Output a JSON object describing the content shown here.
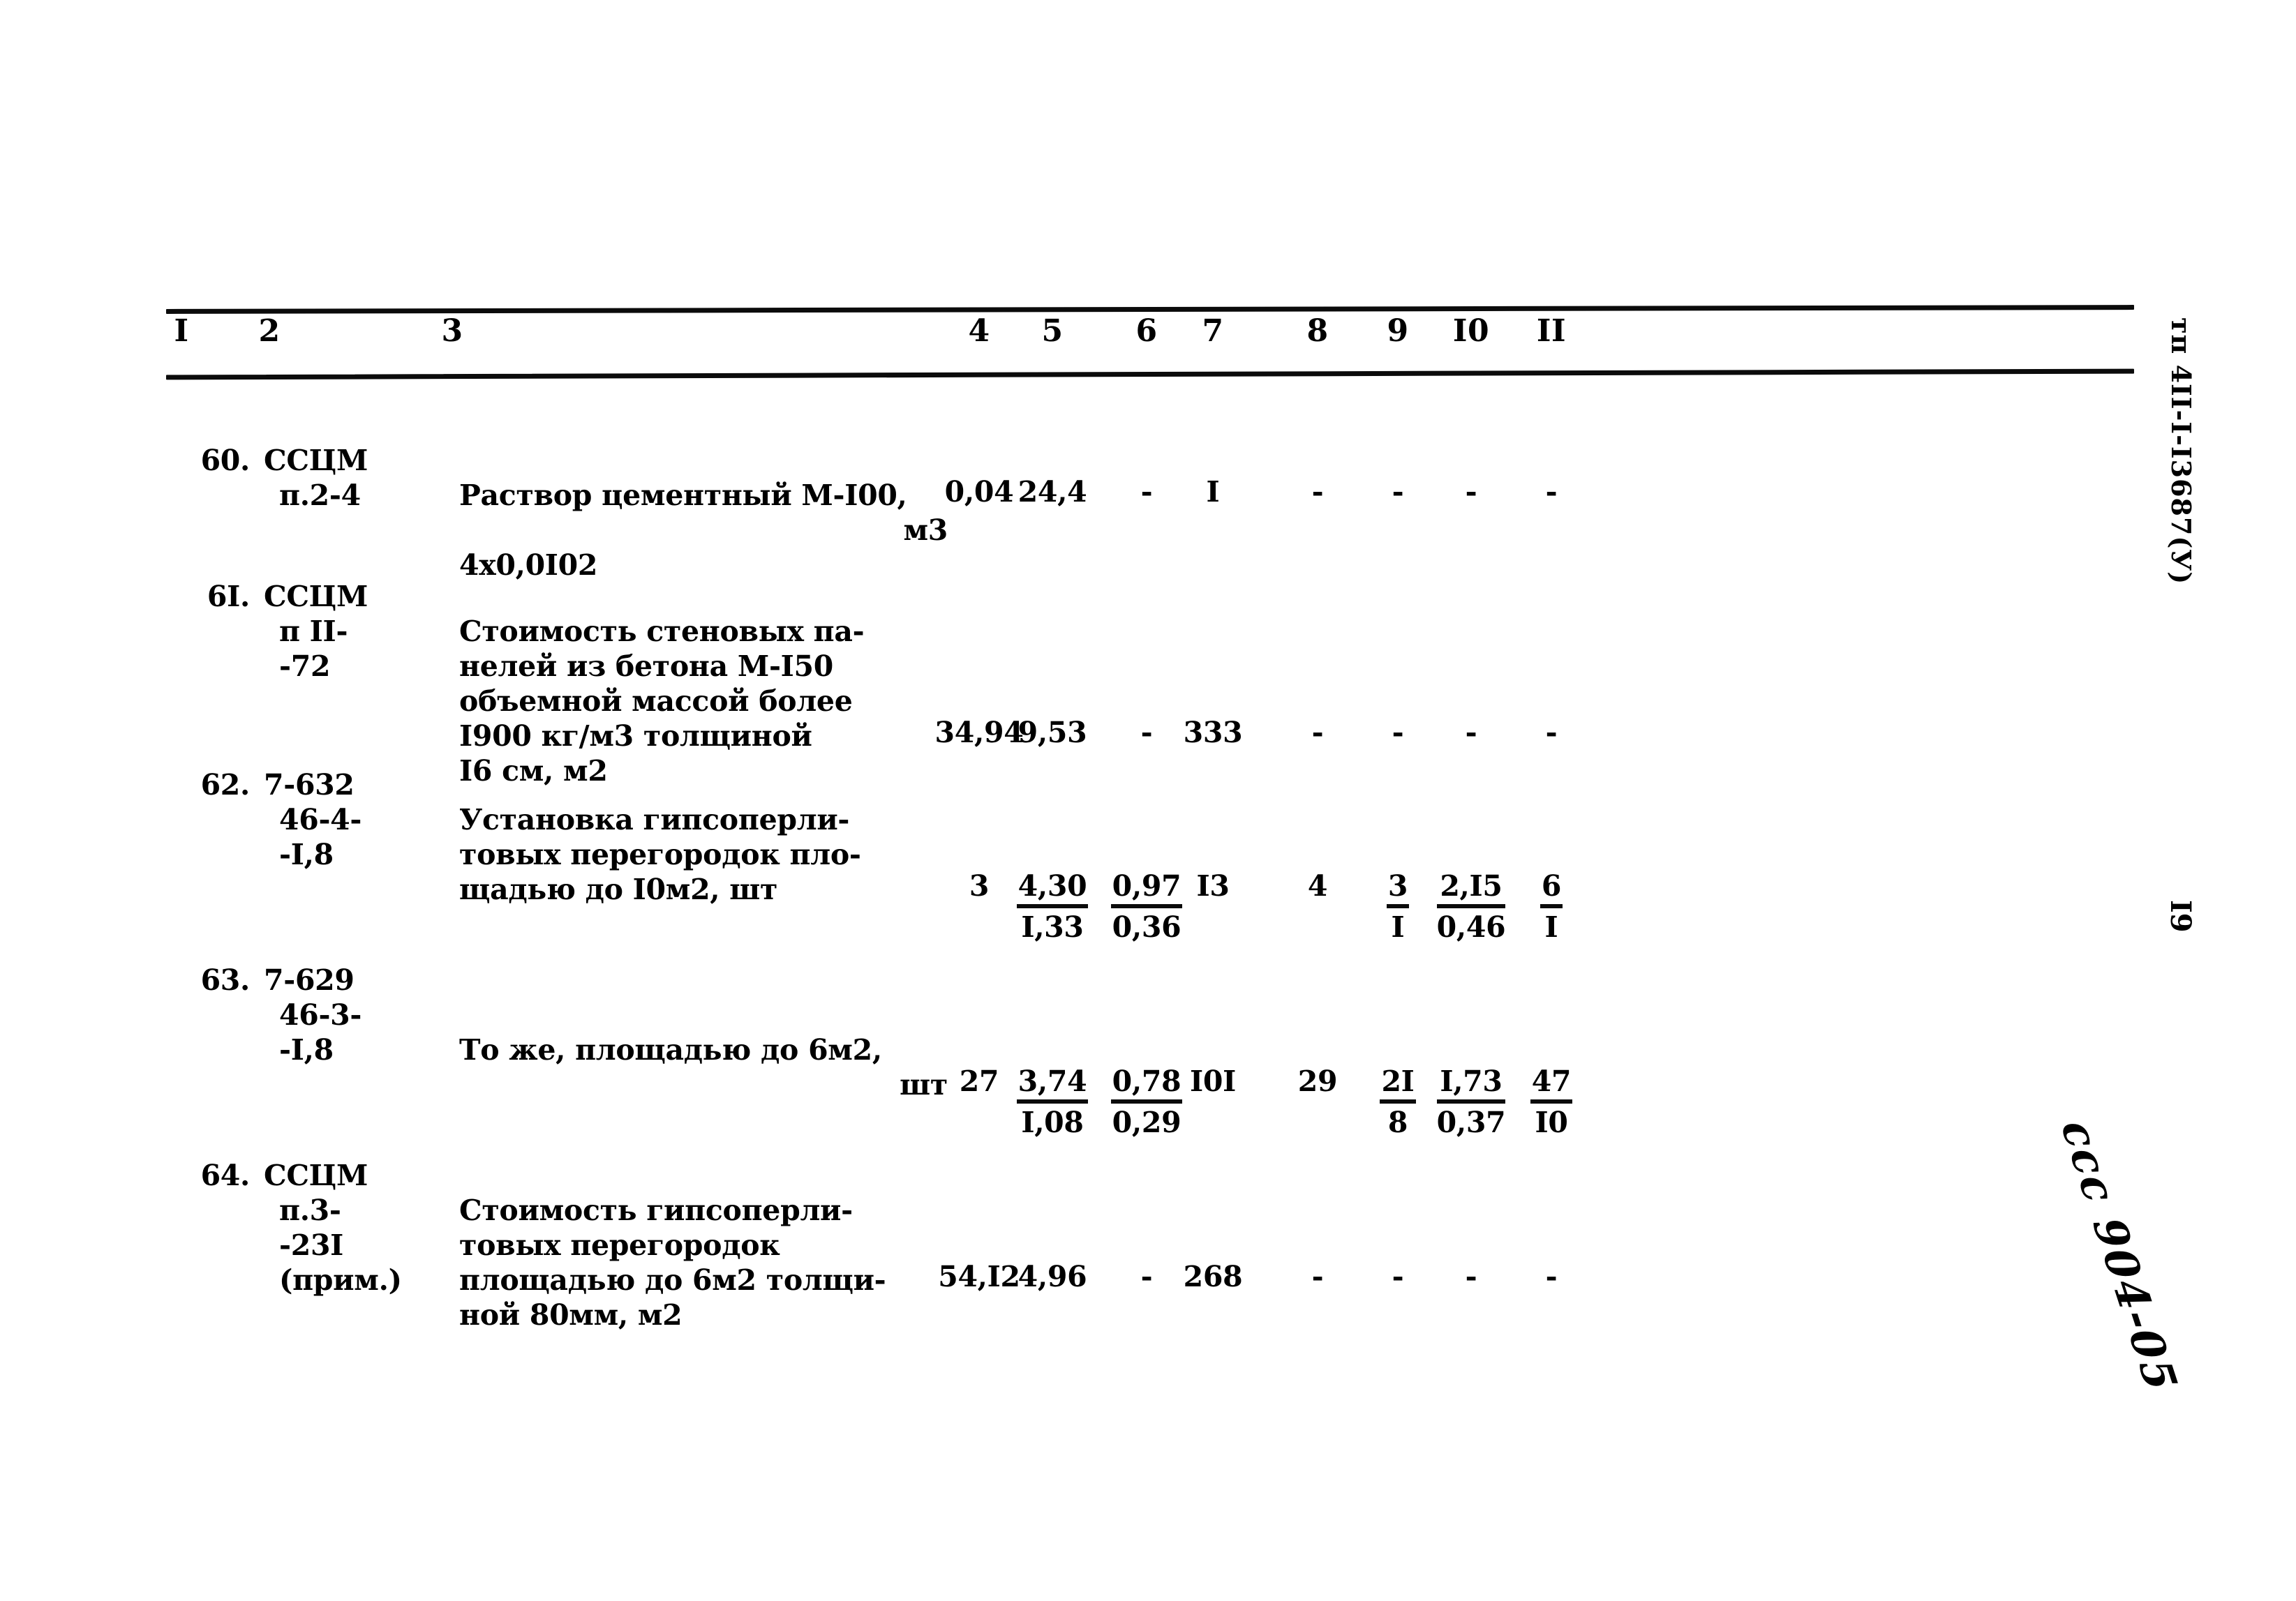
{
  "document": {
    "doc_code_margin": "тп 4II-I-I3687(У)",
    "page_number_margin": "I9",
    "handwritten_note": "ссс 904-05"
  },
  "table": {
    "column_headers": [
      "I",
      "2",
      "3",
      "4",
      "5",
      "6",
      "7",
      "8",
      "9",
      "I0",
      "II"
    ],
    "rows": [
      {
        "no": "60.",
        "code_lines": [
          "ССЦМ",
          "п.2-4"
        ],
        "desc_lines": [
          {
            "text": "Раствор цементный М-I00,",
            "align": "left"
          },
          {
            "text": "м3",
            "align": "right"
          },
          {
            "text": "4x0,0I02",
            "align": "left"
          }
        ],
        "c4": "0,04",
        "c5": "24,4",
        "c6": "-",
        "c7": "I",
        "c8": "-",
        "c9": "-",
        "c10": "-",
        "c11": "-"
      },
      {
        "no": "6I.",
        "code_lines": [
          "ССЦМ",
          "п II-",
          "-72"
        ],
        "desc_lines": [
          {
            "text": "Стоимость стеновых па-",
            "align": "left"
          },
          {
            "text": "нелей из бетона М-I50",
            "align": "left"
          },
          {
            "text": "объемной массой более",
            "align": "left"
          },
          {
            "text": "I900 кг/м3 толщиной",
            "align": "left"
          },
          {
            "text": "I6 см, м2",
            "align": "left"
          }
        ],
        "c4": "34,94",
        "c5": "9,53",
        "c6": "-",
        "c7": "333",
        "c8": "-",
        "c9": "-",
        "c10": "-",
        "c11": "-"
      },
      {
        "no": "62.",
        "code_lines": [
          "7-632",
          "46-4-",
          "-I,8"
        ],
        "desc_lines": [
          {
            "text": "Установка гипсоперли-",
            "align": "left"
          },
          {
            "text": "товых перегородок пло-",
            "align": "left"
          },
          {
            "text": "щадью до I0м2, шт",
            "align": "left"
          }
        ],
        "c4": "3",
        "c5": {
          "num": "4,30",
          "den": "I,33"
        },
        "c6": {
          "num": "0,97",
          "den": "0,36"
        },
        "c7": "I3",
        "c8": "4",
        "c9": {
          "num": "3",
          "den": "I"
        },
        "c10": {
          "num": "2,I5",
          "den": "0,46"
        },
        "c11": {
          "num": "6",
          "den": "I"
        }
      },
      {
        "no": "63.",
        "code_lines": [
          "7-629",
          "46-3-",
          "-I,8"
        ],
        "desc_lines": [
          {
            "text": "То же, площадью до 6м2,",
            "align": "left"
          },
          {
            "text": "шт",
            "align": "right"
          }
        ],
        "c4": "27",
        "c5": {
          "num": "3,74",
          "den": "I,08"
        },
        "c6": {
          "num": "0,78",
          "den": "0,29"
        },
        "c7": "I0I",
        "c8": "29",
        "c9": {
          "num": "2I",
          "den": "8"
        },
        "c10": {
          "num": "I,73",
          "den": "0,37"
        },
        "c11": {
          "num": "47",
          "den": "I0"
        }
      },
      {
        "no": "64.",
        "code_lines": [
          "ССЦМ",
          "п.3-",
          "-23I",
          "(прим.)"
        ],
        "desc_lines": [
          {
            "text": "Стоимость гипсоперли-",
            "align": "left"
          },
          {
            "text": "товых перегородок",
            "align": "left"
          },
          {
            "text": "площадью до 6м2 толщи-",
            "align": "left"
          },
          {
            "text": "ной 80мм, м2",
            "align": "left"
          }
        ],
        "c4": "54,I2",
        "c5": "4,96",
        "c6": "-",
        "c7": "268",
        "c8": "-",
        "c9": "-",
        "c10": "-",
        "c11": "-"
      }
    ]
  }
}
